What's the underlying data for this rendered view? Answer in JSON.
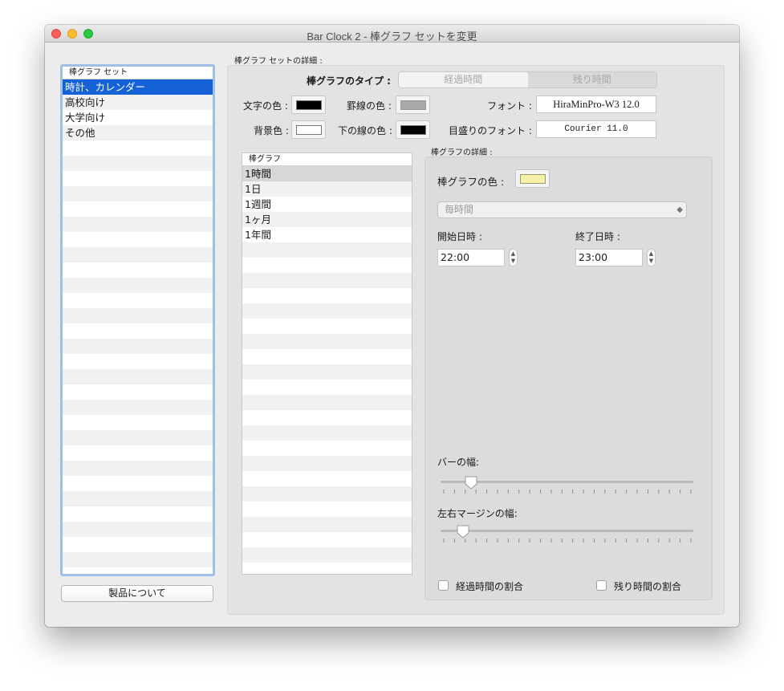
{
  "window": {
    "title": "Bar Clock 2 - 棒グラフ セットを変更"
  },
  "set_list": {
    "header": "棒グラフ セット",
    "items": [
      "時計、カレンダー",
      "高校向け",
      "大学向け",
      "その他"
    ],
    "selected_index": 0
  },
  "about_button": "製品について",
  "details": {
    "group_label": "棒グラフ セットの詳細 :",
    "type_label": "棒グラフのタイプ :",
    "type_options": [
      "経過時間",
      "残り時間"
    ],
    "text_color_label": "文字の色 :",
    "rule_color_label": "罫線の色 :",
    "font_label": "フォント :",
    "font_value": "HiraMinPro-W3 12.0",
    "bg_color_label": "背景色 :",
    "underline_color_label": "下の線の色 :",
    "scale_font_label": "目盛りのフォント :",
    "scale_font_value": "Courier 11.0",
    "colors": {
      "text": "#000000",
      "rule": "#a8a8a8",
      "background": "#ffffff",
      "underline": "#000000"
    }
  },
  "graph_list": {
    "header": "棒グラフ",
    "items": [
      "1時間",
      "1日",
      "1週間",
      "1ヶ月",
      "1年間"
    ],
    "selected_index": 0
  },
  "graph_details": {
    "group_label": "棒グラフの詳細 :",
    "bar_color_label": "棒グラフの色 :",
    "bar_color": "#f7f1a8",
    "interval_popup": "毎時間",
    "start_label": "開始日時 :",
    "start_value": "22:00",
    "end_label": "終了日時 :",
    "end_value": "23:00",
    "bar_width_label": "バーの幅:",
    "bar_width_level": 0.12,
    "margin_label": "左右マージンの幅:",
    "margin_level": 0.09,
    "elapsed_ratio_label": "経過時間の割合",
    "remaining_ratio_label": "残り時間の割合",
    "elapsed_ratio_checked": false,
    "remaining_ratio_checked": false
  }
}
